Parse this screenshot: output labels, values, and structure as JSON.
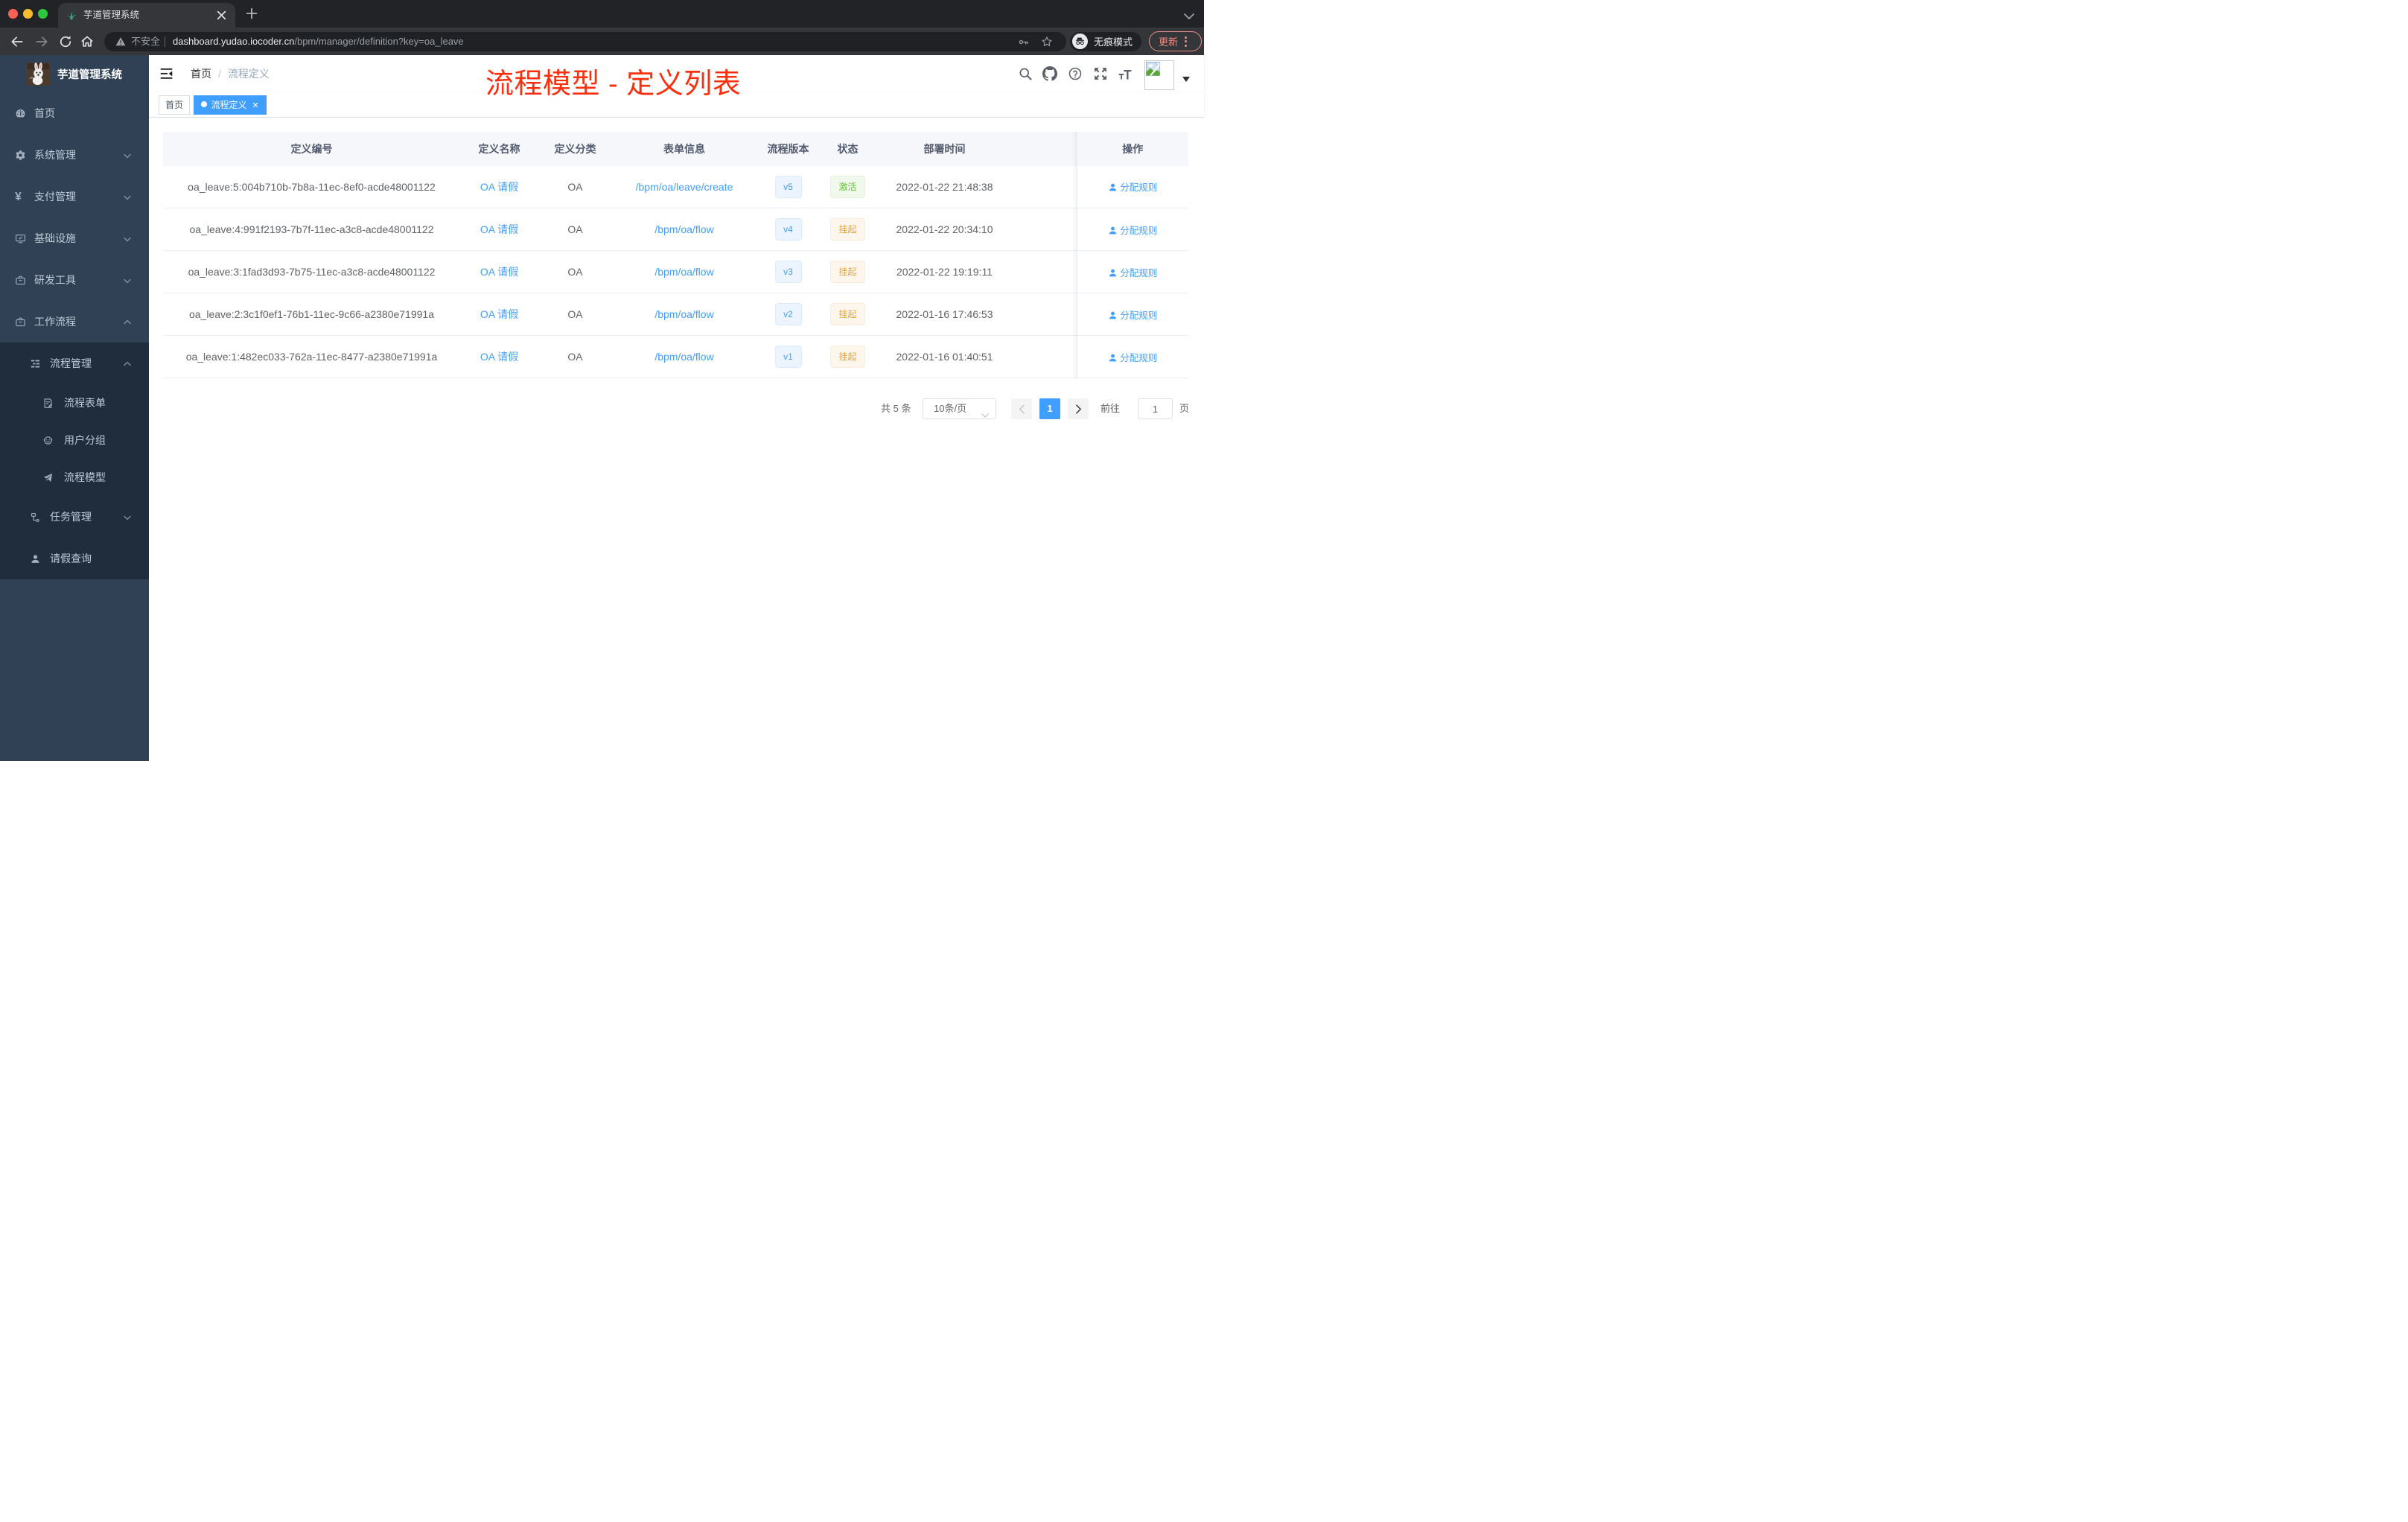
{
  "browser": {
    "tab": {
      "title": "芋道管理系统"
    },
    "address": {
      "security": "不安全",
      "domain": "dashboard.yudao.iocoder.cn",
      "path": "/bpm/manager/definition?key=oa_leave"
    },
    "incognito_label": "无痕模式",
    "update_label": "更新"
  },
  "app": {
    "sidebar": {
      "logo_title": "芋道管理系统",
      "menu": [
        {
          "label": "首页",
          "icon": "dashboard-icon"
        },
        {
          "label": "系统管理",
          "icon": "gear-icon"
        },
        {
          "label": "支付管理",
          "icon": "yen-icon"
        },
        {
          "label": "基础设施",
          "icon": "monitor-icon"
        },
        {
          "label": "研发工具",
          "icon": "toolbox-icon"
        },
        {
          "label": "工作流程",
          "icon": "workflow-icon"
        }
      ],
      "submenu": [
        {
          "label": "流程管理",
          "icon": "tree-table-icon"
        },
        {
          "label": "流程表单",
          "icon": "form-icon"
        },
        {
          "label": "用户分组",
          "icon": "people-icon"
        },
        {
          "label": "流程模型",
          "icon": "paper-plane-icon"
        },
        {
          "label": "任务管理",
          "icon": "tree-icon"
        },
        {
          "label": "请假查询",
          "icon": "user-icon"
        }
      ]
    },
    "navbar": {
      "breadcrumb": {
        "home": "首页",
        "separator": "/",
        "current": "流程定义"
      },
      "annotation": "流程模型 - 定义列表"
    },
    "tags": [
      {
        "label": "首页"
      },
      {
        "label": "流程定义"
      }
    ],
    "table": {
      "columns": [
        "定义编号",
        "定义名称",
        "定义分类",
        "表单信息",
        "流程版本",
        "状态",
        "部署时间",
        "操作"
      ],
      "rows": [
        {
          "id": "oa_leave:5:004b710b-7b8a-11ec-8ef0-acde48001122",
          "name": "OA 请假",
          "category": "OA",
          "form": "/bpm/oa/leave/create",
          "version": "v5",
          "status": "激活",
          "time": "2022-01-22 21:48:38",
          "action": "分配规则"
        },
        {
          "id": "oa_leave:4:991f2193-7b7f-11ec-a3c8-acde48001122",
          "name": "OA 请假",
          "category": "OA",
          "form": "/bpm/oa/flow",
          "version": "v4",
          "status": "挂起",
          "time": "2022-01-22 20:34:10",
          "action": "分配规则"
        },
        {
          "id": "oa_leave:3:1fad3d93-7b75-11ec-a3c8-acde48001122",
          "name": "OA 请假",
          "category": "OA",
          "form": "/bpm/oa/flow",
          "version": "v3",
          "status": "挂起",
          "time": "2022-01-22 19:19:11",
          "action": "分配规则"
        },
        {
          "id": "oa_leave:2:3c1f0ef1-76b1-11ec-9c66-a2380e71991a",
          "name": "OA 请假",
          "category": "OA",
          "form": "/bpm/oa/flow",
          "version": "v2",
          "status": "挂起",
          "time": "2022-01-16 17:46:53",
          "action": "分配规则"
        },
        {
          "id": "oa_leave:1:482ec033-762a-11ec-8477-a2380e71991a",
          "name": "OA 请假",
          "category": "OA",
          "form": "/bpm/oa/flow",
          "version": "v1",
          "status": "挂起",
          "time": "2022-01-16 01:40:51",
          "action": "分配规则"
        }
      ]
    },
    "pagination": {
      "total": "共 5 条",
      "page_size": "10条/页",
      "page": "1",
      "goto_label": "前往",
      "goto_value": "1",
      "unit": "页"
    }
  }
}
